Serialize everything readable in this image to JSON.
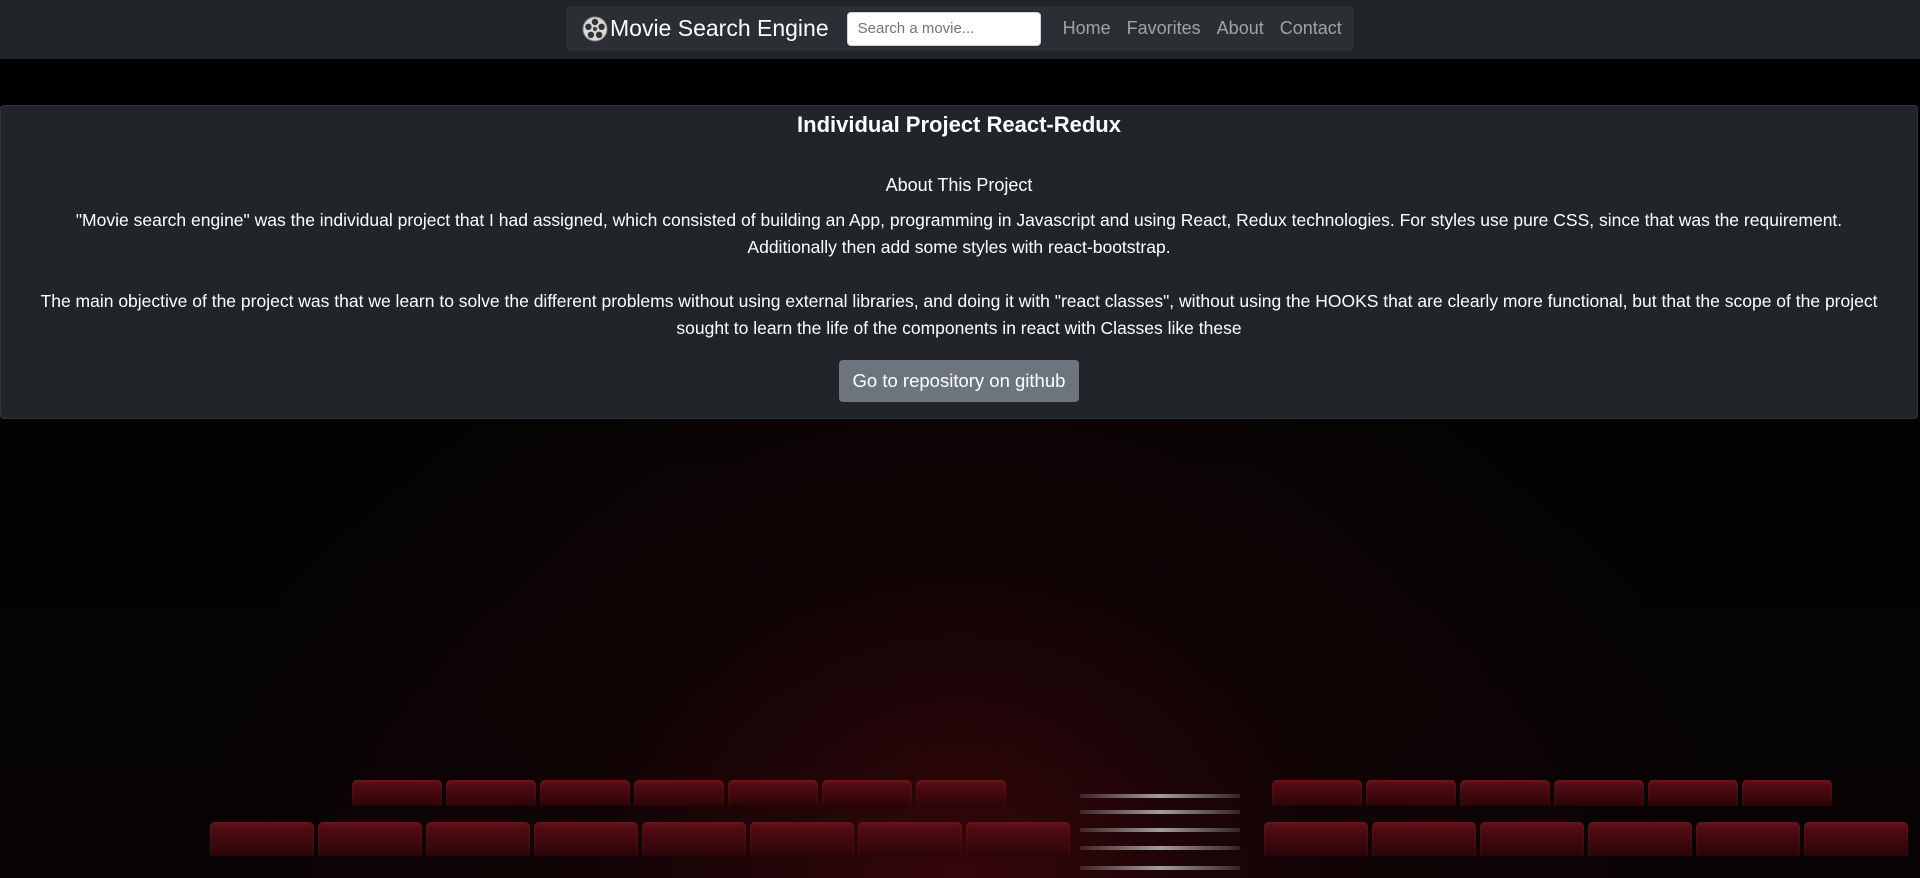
{
  "navbar": {
    "brand_icon": "film-reel-icon",
    "brand_title": "Movie Search Engine",
    "search_placeholder": "Search a movie...",
    "links": [
      "Home",
      "Favorites",
      "About",
      "Contact"
    ]
  },
  "about": {
    "title": "Individual Project React-Redux",
    "subtitle": "About This Project",
    "paragraph_1": "\"Movie search engine\" was the individual project that I had assigned, which consisted of building an App, programming in Javascript and using React, Redux technologies. For styles use pure CSS, since that was the requirement. Additionally then add some styles with react-bootstrap.",
    "paragraph_2": "The main objective of the project was that we learn to solve the different problems without using external libraries, and doing it with \"react classes\", without using the HOOKS that are clearly more functional, but that the scope of the project sought to learn the life of the components in react with Classes like these",
    "button_label": "Go to repository on github"
  },
  "colors": {
    "navbar_bg": "#212529",
    "card_bg": "#212529",
    "button_bg": "#6c757d",
    "seat_red": "#5a0d14"
  },
  "background": {
    "scene": "cinema-seats-background"
  }
}
